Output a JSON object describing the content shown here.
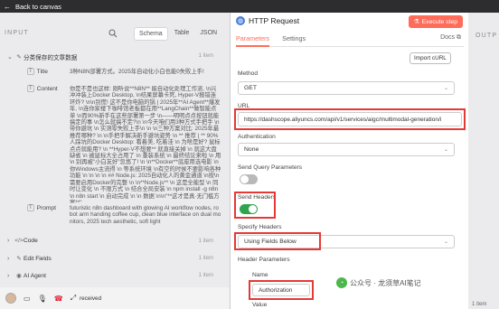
{
  "topbar": {
    "back_label": "Back to canvas"
  },
  "input_panel": {
    "header": "INPUT",
    "tabs": [
      "Schema",
      "Table",
      "JSON"
    ],
    "active_tab": "Schema",
    "tree": {
      "root_label": "分类保存的文章数据",
      "root_count": "1 item",
      "title_label": "Title",
      "title_value": "3种N8N部署方式。2025年自动化小白也能0失败上手!",
      "content_label": "Content",
      "content_value": "你是不是也这样: 刚听说**N8N** 能自动化处理工作流, \\n兴冲冲装上Docker Desktop, \\n结果屏幕卡死, Hyper-V报错连环炸? \\n\\n别慌! 这不是你电脑的锅 | 2025年**AI Agent**爆发年, \\n连你家楼下咖啡馆老板都在用**LangChain**做智能点单 \\n而90%新手在这些部署第一步 \\n——明明点点按钮就能搞定的事 \\n怎么就搞不定?\\n \\n今天咱们用3种方式手把手 \\n 带你避坑 \\n 实测零失败上手\\n \\n \\n三种方案对比: 2025年最推荐哪种? \\n \\n手把手解决新手避坑姿势 \\n ** 推荐 | ** 90%人踩坑的Docker Desktop: 看着美, 吃着洼 \\n 为啥是好? 鼠标点点就能用? \\n **Hyper-V不想要** 就直接关掉 \\n 就这大盘缺省 \\n 被鼠标大全占用了 \\n 重装系统 \\n 最终结论来啦 \\n 用\\n 别再被\"小白友好\"忽悠了! \\n \\n**Docker**底座用选电影 \\n 你Windows主流得 \\n 等系统环境 \\n有空的时候不要影响各种功能 \\n \\n \\n \\n ## Node.js: 2025自动化人的黄金通道 \\n按\\n 需要启用Docker的完整 \\n \\n**Node.js** \\n 这是全能型 \\n 同时让变化 \\n 不限方式 \\n 结合全局安装 \\n npm install -g n8n \\n n8n start \\n 启动完成 \\n \\n 数据 \\n\\n\"**这才是真·无门槛方案**\"",
      "prompt_label": "Prompt",
      "prompt_value": "futuristic n8n dashboard with glowing AI workflow nodes, robot arm handing coffee cup, clean blue interface on dual monitors, 2025 tech aesthetic, soft light",
      "code_label": "Code",
      "code_count": "1 item",
      "edit_label": "Edit Fields",
      "edit_count": "1 item",
      "ai_label": "AI Agent",
      "ai_count": "1 item"
    },
    "bottom": {
      "received_text": "received"
    }
  },
  "http_panel": {
    "title": "HTTP Request",
    "execute_label": "Execute step",
    "tabs": [
      "Parameters",
      "Settings"
    ],
    "docs_label": "Docs",
    "import_label": "Import cURL",
    "method_label": "Method",
    "method_value": "GET",
    "url_label": "URL",
    "url_value": "https://dashscope.aliyuncs.com/api/v1/services/aigc/multimodal-generation/i",
    "auth_label": "Authentication",
    "auth_value": "None",
    "send_query_label": "Send Query Parameters",
    "send_query_on": false,
    "send_headers_label": "Send Headers",
    "send_headers_on": true,
    "specify_headers_label": "Specify Headers",
    "specify_headers_value": "Using Fields Below",
    "header_params_label": "Header Parameters",
    "name_label": "Name",
    "name_value": "Authorization",
    "value_label": "Value",
    "accent_color": "#ff6d5a",
    "toggle_on_color": "#2ea44f",
    "highlight_color": "#e53935"
  },
  "output_panel": {
    "header": "OUTP"
  },
  "watermark": {
    "text": "公众号 · 龙须草AI笔记"
  },
  "bottom_right": {
    "text": "1 item"
  }
}
